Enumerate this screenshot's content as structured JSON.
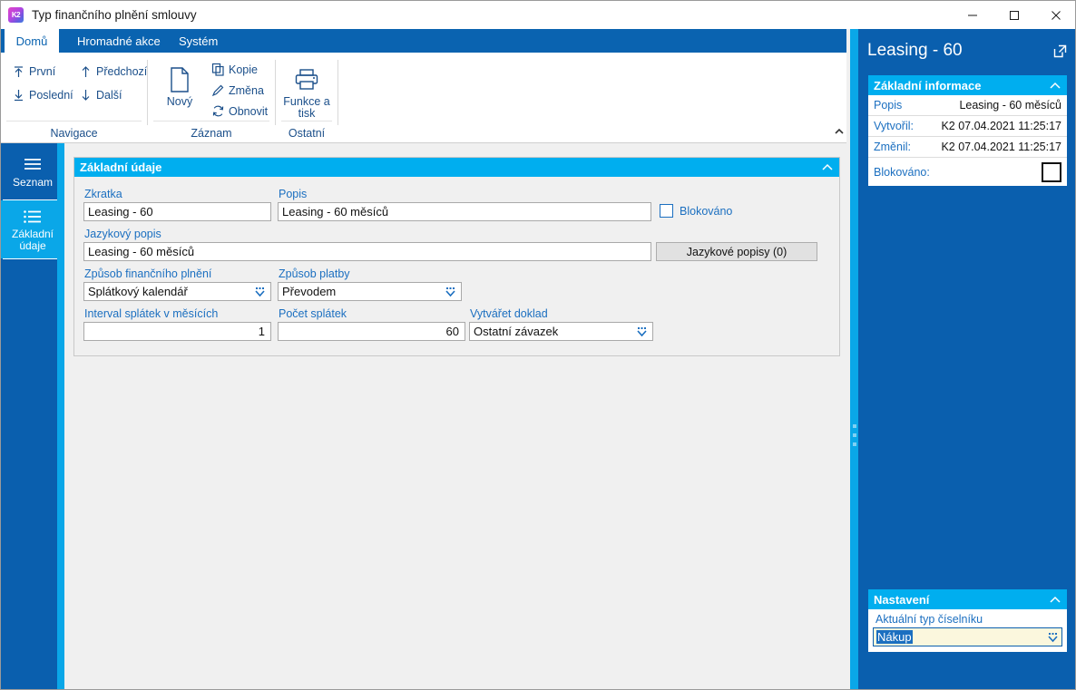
{
  "window": {
    "title": "Typ finančního plnění smlouvy",
    "app_icon": "k2-logo-icon",
    "minimize": "minimize-icon",
    "maximize": "maximize-icon",
    "close": "close-icon"
  },
  "ribbon": {
    "tabs": [
      {
        "label": "Domů",
        "active": true
      },
      {
        "label": "Hromadné akce",
        "active": false
      },
      {
        "label": "Systém",
        "active": false
      }
    ],
    "groups": [
      {
        "label": "Navigace",
        "commands": [
          {
            "label": "První",
            "icon": "arrow-up-to-line-icon"
          },
          {
            "label": "Předchozí",
            "icon": "arrow-up-icon"
          },
          {
            "label": "Poslední",
            "icon": "arrow-down-to-line-icon"
          },
          {
            "label": "Další",
            "icon": "arrow-down-icon"
          }
        ]
      },
      {
        "label": "Záznam",
        "commands": [
          {
            "label": "Nový",
            "icon": "new-document-icon"
          },
          {
            "label": "Kopie",
            "icon": "copy-icon"
          },
          {
            "label": "Změna",
            "icon": "pencil-icon"
          },
          {
            "label": "Obnovit",
            "icon": "refresh-icon"
          }
        ]
      },
      {
        "label": "Ostatní",
        "commands": [
          {
            "label": "Funkce a tisk",
            "icon": "printer-icon"
          }
        ]
      }
    ],
    "collapse_icon": "chevron-up-icon"
  },
  "sidebar": {
    "items": [
      {
        "label": "Seznam",
        "icon": "list-lines-icon",
        "active": false
      },
      {
        "label": "Základní údaje",
        "icon": "bullet-list-icon",
        "active": true
      }
    ]
  },
  "form": {
    "panel_title": "Základní údaje",
    "collapse_icon": "chevron-up-icon",
    "fields": {
      "zkratka": {
        "label": "Zkratka",
        "value": "Leasing - 60"
      },
      "popis": {
        "label": "Popis",
        "value": "Leasing - 60 měsíců"
      },
      "blokovano": {
        "label": "Blokováno",
        "checked": false
      },
      "jazykovy_popis": {
        "label": "Jazykový popis",
        "value": "Leasing - 60 měsíců"
      },
      "jazykove_popisy_button": {
        "label": "Jazykové popisy (0)"
      },
      "zpusob_plneni": {
        "label": "Způsob finančního plnění",
        "value": "Splátkový kalendář"
      },
      "zpusob_platby": {
        "label": "Způsob platby",
        "value": "Převodem"
      },
      "interval_splatek": {
        "label": "Interval splátek v měsících",
        "value": "1"
      },
      "pocet_splatek": {
        "label": "Počet splátek",
        "value": "60"
      },
      "vytvaret_doklad": {
        "label": "Vytvářet doklad",
        "value": "Ostatní závazek"
      }
    },
    "dropdown_icon": "dropdown-arrow-icon"
  },
  "splitter": {
    "grip_icon": "splitter-grip-icon"
  },
  "right_panel": {
    "title": "Leasing - 60",
    "expand_icon": "open-external-icon",
    "info_card": {
      "title": "Základní informace",
      "collapse_icon": "chevron-up-icon",
      "rows": [
        {
          "key": "Popis",
          "value": "Leasing - 60 měsíců",
          "type": "text"
        },
        {
          "key": "Vytvořil:",
          "value": "K2 07.04.2021 11:25:17",
          "type": "text"
        },
        {
          "key": "Změnil:",
          "value": "K2 07.04.2021 11:25:17",
          "type": "text"
        },
        {
          "key": "Blokováno:",
          "value": "",
          "type": "checkbox"
        }
      ]
    },
    "settings_card": {
      "title": "Nastavení",
      "collapse_icon": "chevron-up-icon",
      "field_label": "Aktuální typ číselníku",
      "field_value": "Nákup",
      "dropdown_icon": "dropdown-arrow-icon"
    }
  },
  "colors": {
    "ribbon_blue": "#0a63b0",
    "sidebar_blue": "#0a5fae",
    "accent_cyan": "#00aeef",
    "label_blue": "#1b6fc0"
  }
}
